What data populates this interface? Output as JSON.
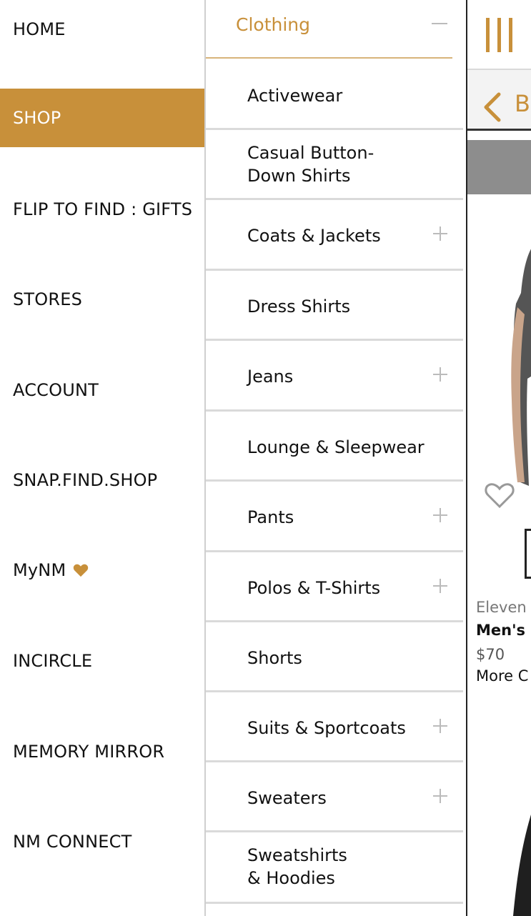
{
  "left_menu": {
    "items": [
      {
        "label": "HOME"
      },
      {
        "label": "SHOP"
      },
      {
        "label": "FLIP TO FIND : GIFTS"
      },
      {
        "label": "STORES"
      },
      {
        "label": "ACCOUNT"
      },
      {
        "label": "SNAP.FIND.SHOP"
      },
      {
        "label": "MyNM"
      },
      {
        "label": "INCIRCLE"
      },
      {
        "label": "MEMORY MIRROR"
      },
      {
        "label": "NM CONNECT"
      }
    ],
    "active": "SHOP"
  },
  "submenu": {
    "title": "Clothing",
    "items": [
      {
        "label": "Activewear",
        "expandable": false
      },
      {
        "label": "Casual Button-\nDown Shirts",
        "expandable": false
      },
      {
        "label": "Coats & Jackets",
        "expandable": true
      },
      {
        "label": "Dress Shirts",
        "expandable": false
      },
      {
        "label": "Jeans",
        "expandable": true
      },
      {
        "label": "Lounge & Sleepwear",
        "expandable": false
      },
      {
        "label": "Pants",
        "expandable": true
      },
      {
        "label": "Polos & T-Shirts",
        "expandable": true
      },
      {
        "label": "Shorts",
        "expandable": false
      },
      {
        "label": "Suits & Sportcoats",
        "expandable": true
      },
      {
        "label": "Sweaters",
        "expandable": true
      },
      {
        "label": "Sweatshirts\n& Hoodies",
        "expandable": false
      }
    ]
  },
  "right_panel": {
    "back_label": "B",
    "product": {
      "brand": "Eleven",
      "name": "Men's",
      "price": "$70",
      "more": "More C"
    }
  },
  "colors": {
    "accent": "#c8903a",
    "divider": "#dadada"
  }
}
